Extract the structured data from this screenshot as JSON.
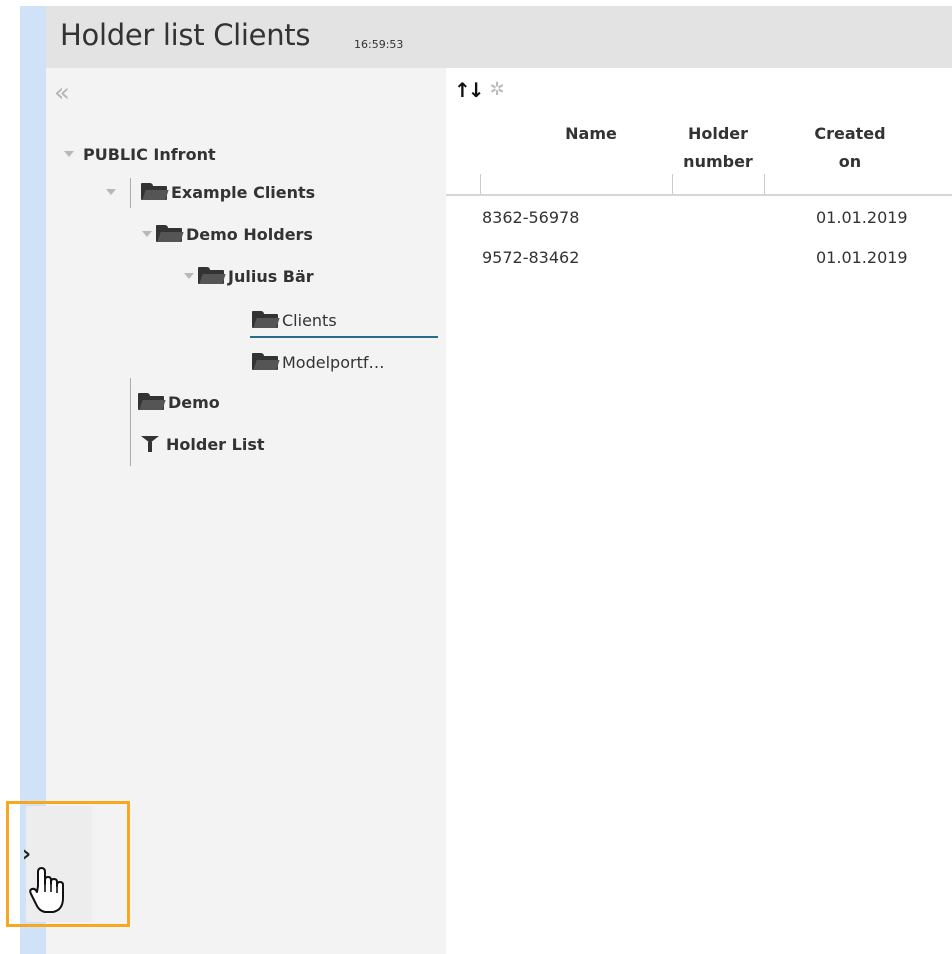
{
  "header": {
    "title": "Holder list Clients",
    "time": "16:59:53"
  },
  "sidebar": {
    "collapse_icon": "double-chevron-left-icon"
  },
  "tree": {
    "items": [
      {
        "label": "PUBLIC Infront",
        "bold": true,
        "icon": ""
      },
      {
        "label": "Example Clients",
        "bold": true,
        "icon": "folder-icon"
      },
      {
        "label": "Demo Holders",
        "bold": true,
        "icon": "folder-icon"
      },
      {
        "label": "Julius Bär",
        "bold": true,
        "icon": "folder-icon"
      },
      {
        "label": "Clients",
        "bold": false,
        "icon": "folder-icon",
        "selected": true
      },
      {
        "label": "Modelportf…",
        "bold": false,
        "icon": "folder-icon"
      },
      {
        "label": "Demo",
        "bold": true,
        "icon": "folder-icon"
      },
      {
        "label": "Holder List",
        "bold": true,
        "icon": "filter-icon"
      }
    ]
  },
  "toolbar": {
    "sort_icon": "sort-arrows-icon",
    "settings_icon": "gear-icon"
  },
  "table": {
    "columns": [
      {
        "line1": "Name",
        "line2": ""
      },
      {
        "line1": "Holder",
        "line2": "number"
      },
      {
        "line1": "Created",
        "line2": "on"
      }
    ],
    "rows": [
      {
        "name": "8362-56978",
        "holder_number": "",
        "created_on": "01.01.2019"
      },
      {
        "name": "9572-83462",
        "holder_number": "",
        "created_on": "01.01.2019"
      }
    ]
  },
  "expand_button": {
    "label": "›",
    "icon": "chevron-right-icon"
  },
  "cursor": {
    "icon": "hand-pointer-icon"
  },
  "colors": {
    "rail": "#cfe2f7",
    "highlight": "#f5a820",
    "selected_underline": "#2b6a8a"
  }
}
